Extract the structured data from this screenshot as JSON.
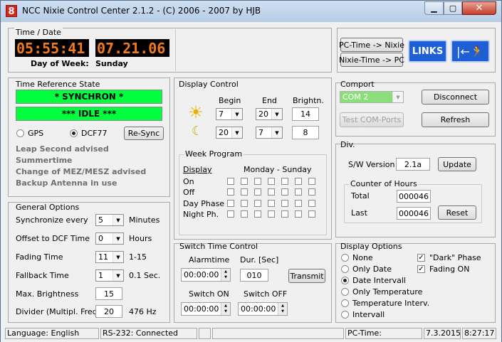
{
  "window": {
    "title": "NCC Nixie Control Center 2.1.2 - (C) 2006 - 2007 by HJB",
    "app_icon": "8"
  },
  "time_date": {
    "caption": "Time / Date",
    "time": "05:55:41",
    "date": "07.21.06",
    "dow_label": "Day of Week:",
    "dow_value": "Sunday"
  },
  "pc_buttons": {
    "pc_to_nixie": "PC-Time -> Nixie",
    "nixie_to_pc": "Nixie-Time -> PC",
    "links": "LINKS"
  },
  "time_ref": {
    "caption": "Time Reference State",
    "state1": "* SYNCHRON *",
    "state2": "*** IDLE ***",
    "gps": "GPS",
    "dcf": "DCF77",
    "resync": "Re-Sync",
    "notes": [
      "Leap Second advised",
      "Summertime",
      "Change of MEZ/MESZ advised",
      "Backup Antenna in use"
    ]
  },
  "display_control": {
    "caption": "Display Control",
    "h_begin": "Begin",
    "h_end": "End",
    "h_bright": "Brightn.",
    "day": {
      "begin": "7",
      "end": "20",
      "bright": "14"
    },
    "night": {
      "begin": "20",
      "end": "7",
      "bright": "8"
    }
  },
  "week_program": {
    "caption": "Week Program",
    "display": "Display",
    "range": "Monday - Sunday",
    "rows": [
      "On",
      "Off",
      "Day Phase",
      "Night Ph."
    ]
  },
  "comport": {
    "caption": "Comport",
    "port": "COM 2",
    "disconnect": "Disconnect",
    "test": "Test COM-Ports",
    "refresh": "Refresh"
  },
  "div": {
    "caption": "Div.",
    "sw_label": "S/W Version",
    "sw_value": "2.1a",
    "update": "Update",
    "counter_caption": "Counter of Hours",
    "total_label": "Total",
    "total_value": "000046",
    "last_label": "Last",
    "last_value": "000046",
    "reset": "Reset"
  },
  "general": {
    "caption": "General Options",
    "sync_label": "Synchronize every",
    "sync_value": "5",
    "sync_unit": "Minutes",
    "offset_label": "Offset to DCF Time",
    "offset_value": "0",
    "offset_unit": "Hours",
    "fading_label": "Fading Time",
    "fading_value": "11",
    "fading_unit": "1-15",
    "fallback_label": "Fallback Time",
    "fallback_value": "1",
    "fallback_unit": "0.1 Sec.",
    "maxbright_label": "Max. Brightness",
    "maxbright_value": "15",
    "divider_label": "Divider (Multipl. Frequ.)",
    "divider_value": "20",
    "divider_unit": "476 Hz"
  },
  "switch_time": {
    "caption": "Switch Time Control",
    "alarm_label": "Alarmtime",
    "alarm_value": "00:00:00",
    "dur_label": "Dur. [Sec]",
    "dur_value": "010",
    "transmit": "Transmit",
    "on_label": "Switch ON",
    "on_value": "00:00:00",
    "off_label": "Switch OFF",
    "off_value": "00:00:00"
  },
  "display_options": {
    "caption": "Display Options",
    "none": "None",
    "only_date": "Only Date",
    "date_interval": "Date Intervall",
    "only_temp": "Only Temperature",
    "temp_interval": "Temperature Interv.",
    "interval": "Intervall",
    "dark": "\"Dark\" Phase",
    "fading_on": "Fading ON"
  },
  "statusbar": {
    "language": "Language: English",
    "rs232": "RS-232: Connected",
    "pctime_label": "PC-Time:",
    "date": "7.3.2015",
    "time": "8:27:17"
  },
  "colors": {
    "led_orange": "#f37a1a",
    "green_state": "#00ff3c",
    "links_blue": "#1e5fd6"
  }
}
